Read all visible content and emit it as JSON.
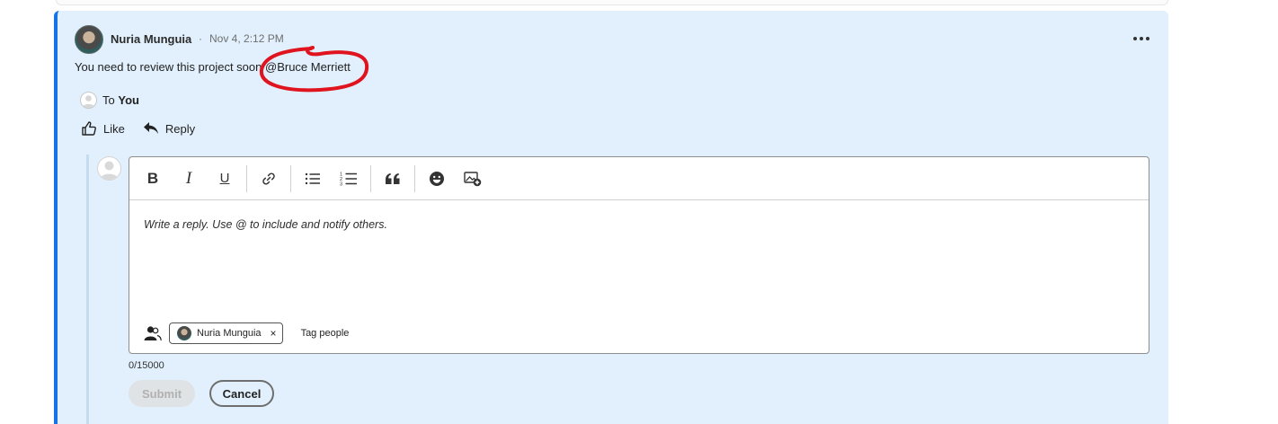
{
  "comment": {
    "author": "Nuria Munguia",
    "separator": "·",
    "timestamp": "Nov 4, 2:12 PM",
    "text_before_mention": "You need to review this project soon ",
    "mention": "@Bruce Merriett",
    "recipient_prefix": "To",
    "recipient": "You",
    "like_label": "Like",
    "reply_label": "Reply"
  },
  "editor": {
    "toolbar": [
      {
        "name": "bold-button",
        "glyph": "B"
      },
      {
        "name": "italic-button",
        "glyph": "I"
      },
      {
        "name": "underline-button",
        "glyph": "U"
      }
    ],
    "placeholder": "Write a reply. Use @ to include and notify others.",
    "tagged_person": "Nuria Munguia",
    "remove_glyph": "×",
    "tag_people_label": "Tag people",
    "char_count": "0/15000"
  },
  "buttons": {
    "submit": "Submit",
    "cancel": "Cancel"
  },
  "colors": {
    "card_bg": "#e1f0fc",
    "accent": "#1473e6",
    "annotation": "#e0141e"
  }
}
